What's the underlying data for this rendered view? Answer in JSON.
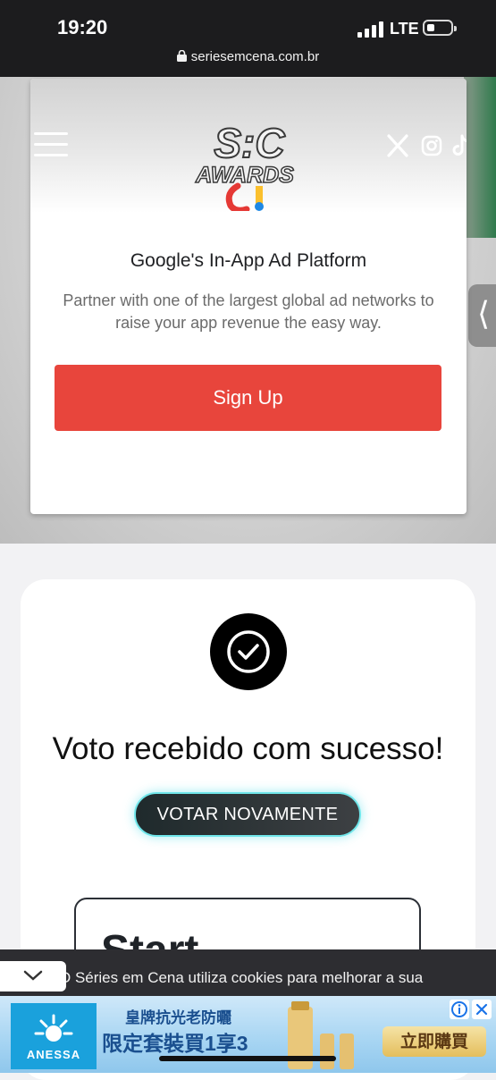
{
  "status": {
    "time": "19:20",
    "network": "LTE",
    "url": "seriesemcena.com.br"
  },
  "ad": {
    "logo_text_top": "S:C",
    "logo_text_bottom": "AWARDS",
    "title": "Google's In-App Ad Platform",
    "description": "Partner with one of the largest global ad networks to raise your app revenue the easy way.",
    "cta_label": "Sign Up",
    "cta_color": "#e8453c"
  },
  "vote": {
    "title": "Voto recebido com sucesso!",
    "again_button": "VOTAR NOVAMENTE",
    "start_text": "Start"
  },
  "cookie": {
    "text": "O Séries em Cena utiliza cookies para melhorar a sua"
  },
  "banner": {
    "brand": "ANESSA",
    "line1": "皇牌抗光老防曬",
    "line2": "限定套裝買1享3",
    "cta": "立即購買"
  },
  "icons": [
    "menu-icon",
    "x-icon",
    "instagram-icon",
    "tiktok-icon",
    "lock-icon",
    "chevron-left-icon",
    "check-icon",
    "chevron-down-icon",
    "adchoices-icon",
    "close-icon"
  ]
}
